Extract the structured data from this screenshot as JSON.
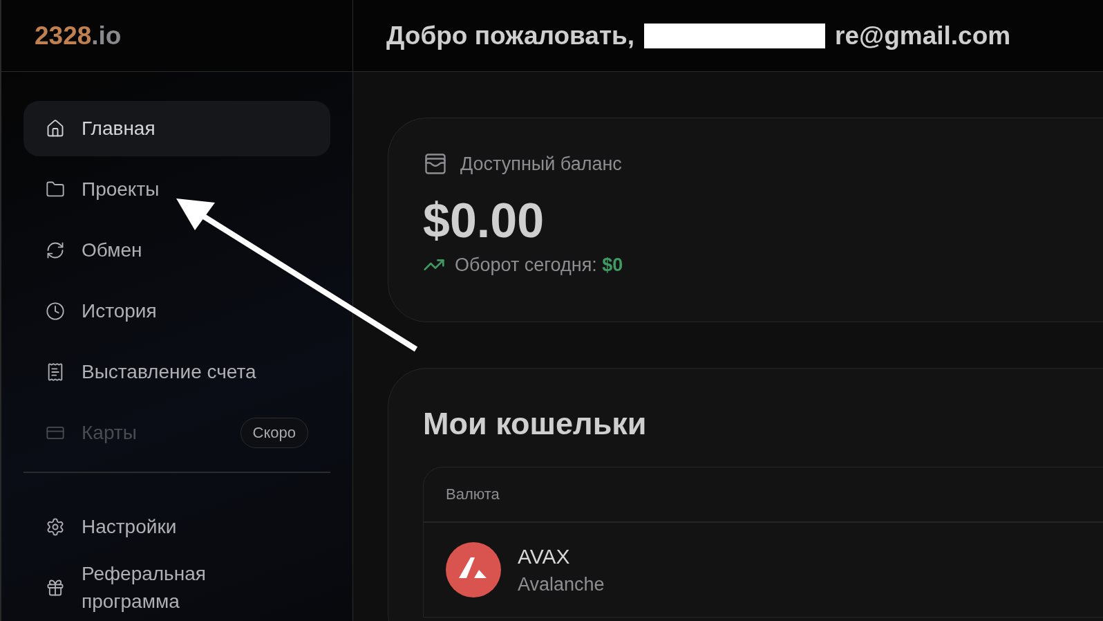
{
  "logo": {
    "brand": "2328",
    "suffix": ".io"
  },
  "header": {
    "welcome": "Добро пожаловать,",
    "email_visible": "re@gmail.com"
  },
  "sidebar": {
    "items": [
      {
        "kind": "home",
        "label": "Главная",
        "selected": true,
        "disabled": false
      },
      {
        "kind": "folder",
        "label": "Проекты",
        "selected": false,
        "disabled": false
      },
      {
        "kind": "exchange",
        "label": "Обмен",
        "selected": false,
        "disabled": false
      },
      {
        "kind": "history",
        "label": "История",
        "selected": false,
        "disabled": false
      },
      {
        "kind": "invoice",
        "label": "Выставление счета",
        "selected": false,
        "disabled": false
      },
      {
        "kind": "card",
        "label": "Карты",
        "selected": false,
        "disabled": true,
        "badge": "Скоро"
      }
    ],
    "bottom_items": [
      {
        "kind": "settings",
        "label": "Настройки",
        "selected": false,
        "disabled": false
      },
      {
        "kind": "gift",
        "label": "Реферальная программа",
        "selected": false,
        "disabled": false
      }
    ]
  },
  "balance": {
    "label": "Доступный баланс",
    "amount": "$0.00",
    "turnover_label": "Оборот сегодня:",
    "turnover_value": "$0"
  },
  "wallets": {
    "title": "Мои кошельки",
    "columns": [
      "Валюта"
    ],
    "rows": [
      {
        "symbol": "AVAX",
        "name": "Avalanche",
        "color": "#d9534f"
      }
    ]
  }
}
